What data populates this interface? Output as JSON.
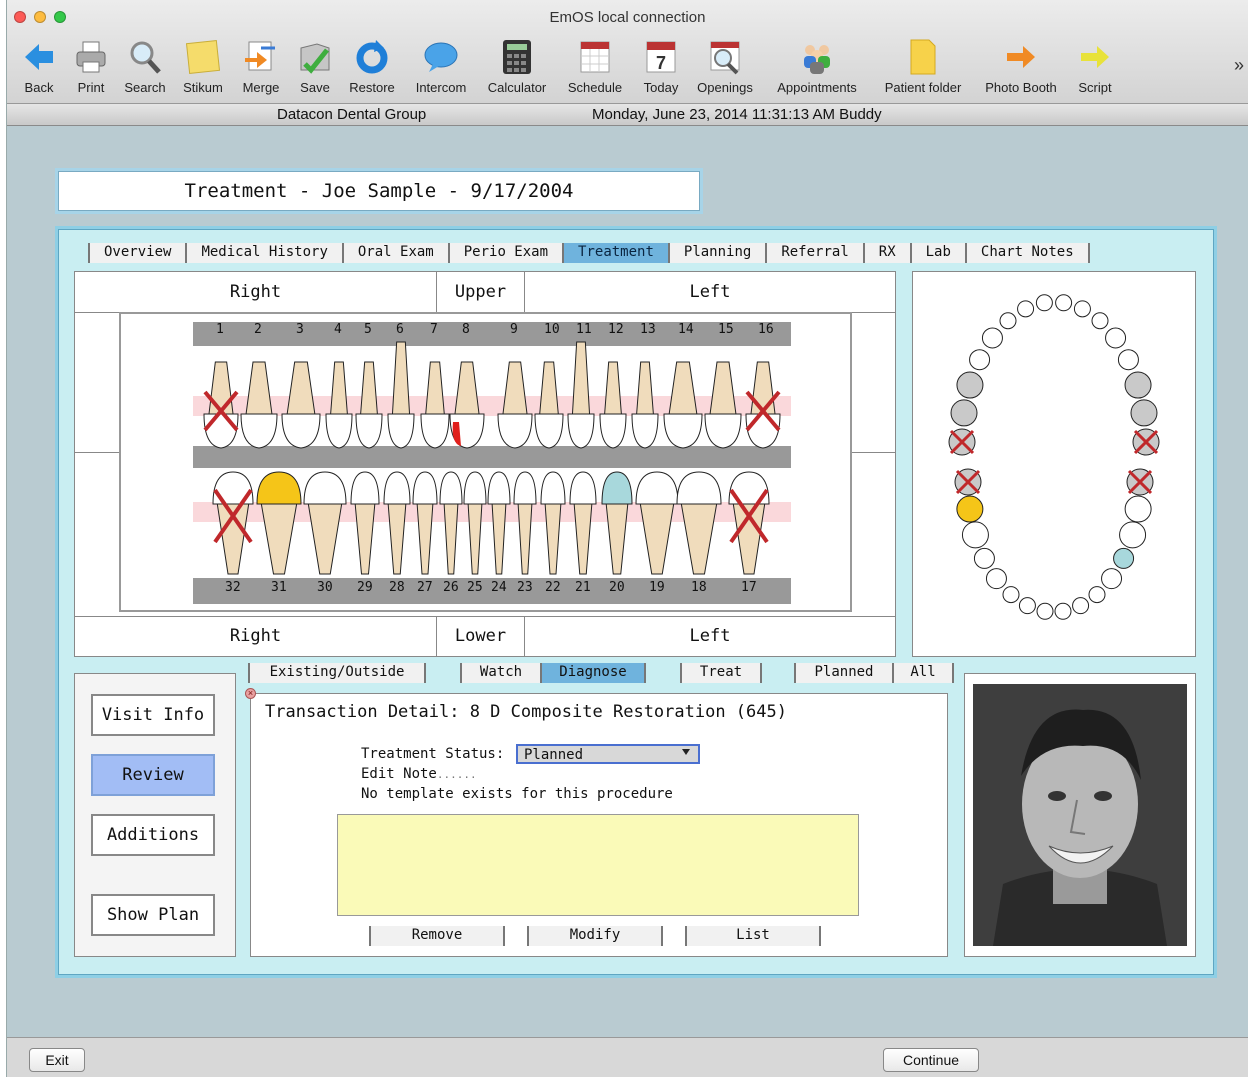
{
  "window": {
    "title": "EmOS local connection"
  },
  "toolbar": {
    "items": [
      {
        "label": "Back",
        "icon": "back-arrow-icon"
      },
      {
        "label": "Print",
        "icon": "printer-icon"
      },
      {
        "label": "Search",
        "icon": "magnifier-icon"
      },
      {
        "label": "Stikum",
        "icon": "sticky-note-icon"
      },
      {
        "label": "Merge",
        "icon": "merge-icon"
      },
      {
        "label": "Save",
        "icon": "save-icon"
      },
      {
        "label": "Restore",
        "icon": "restore-icon"
      },
      {
        "label": "Intercom",
        "icon": "speech-bubble-icon"
      },
      {
        "label": "Calculator",
        "icon": "calculator-icon"
      },
      {
        "label": "Schedule",
        "icon": "calendar-icon"
      },
      {
        "label": "Today",
        "icon": "today-calendar-icon"
      },
      {
        "label": "Openings",
        "icon": "openings-search-icon"
      },
      {
        "label": "Appointments",
        "icon": "people-icon"
      },
      {
        "label": "Patient folder",
        "icon": "folder-icon"
      },
      {
        "label": "Photo Booth",
        "icon": "orange-arrow-icon"
      },
      {
        "label": "Script",
        "icon": "yellow-arrow-icon"
      }
    ],
    "more": "»"
  },
  "status": {
    "practice": "Datacon Dental Group",
    "datetime": "Monday, June 23, 2014  11:31:13 AM  Buddy"
  },
  "record_title": "Treatment - Joe Sample -  9/17/2004",
  "tabs": [
    "Overview",
    "Medical History",
    "Oral Exam",
    "Perio Exam",
    "Treatment",
    "Planning",
    "Referral",
    "RX",
    "Lab",
    "Chart Notes"
  ],
  "active_tab": "Treatment",
  "chart": {
    "upper_right": "Right",
    "upper_mid": "Upper",
    "upper_left": "Left",
    "lower_right": "Right",
    "lower_mid": "Lower",
    "lower_left": "Left",
    "upper_numbers": [
      "1",
      "2",
      "3",
      "4",
      "5",
      "6",
      "7",
      "8",
      "9",
      "10",
      "11",
      "12",
      "13",
      "14",
      "15",
      "16"
    ],
    "lower_numbers": [
      "32",
      "31",
      "30",
      "29",
      "28",
      "27",
      "26",
      "25",
      "24",
      "23",
      "22",
      "21",
      "20",
      "19",
      "18",
      "17"
    ],
    "colors": {
      "enamel": "#ffffff",
      "root": "#f0dcbc",
      "gum": "#f5b8bd",
      "missing": "#c0282b",
      "restoration": "#f5c518",
      "watch": "#a8d8dc",
      "decay": "#e0201c"
    }
  },
  "subtabs": {
    "existing": "Existing/Outside",
    "watch": "Watch",
    "diagnose": "Diagnose",
    "treat": "Treat",
    "planned": "Planned",
    "all": "All"
  },
  "side_buttons": {
    "visit_info": "Visit Info",
    "review": "Review",
    "additions": "Additions",
    "show_plan": "Show Plan"
  },
  "detail": {
    "title": "Transaction Detail: 8 D Composite Restoration (645)",
    "status_label": "Treatment Status:",
    "status_value": "Planned",
    "edit_note": "Edit Note",
    "edit_note_dots": "......",
    "template_msg": "No template exists for this procedure",
    "remove": "Remove",
    "modify": "Modify",
    "list": "List"
  },
  "bottom": {
    "exit": "Exit",
    "continue": "Continue"
  }
}
